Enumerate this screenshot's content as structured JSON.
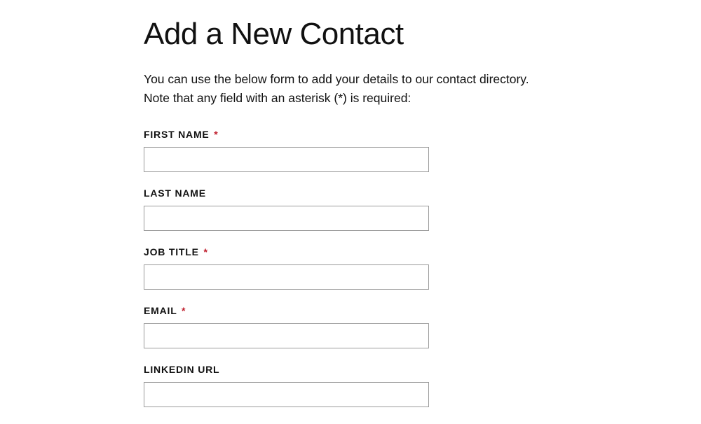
{
  "page": {
    "title": "Add a New Contact",
    "intro": "You can use the below form to add your details to our contact directory. Note that any field with an asterisk (*) is required:"
  },
  "form": {
    "fields": [
      {
        "label": "FIRST NAME",
        "required": true,
        "value": ""
      },
      {
        "label": "LAST NAME",
        "required": false,
        "value": ""
      },
      {
        "label": "JOB TITLE",
        "required": true,
        "value": ""
      },
      {
        "label": "EMAIL",
        "required": true,
        "value": ""
      },
      {
        "label": "LINKEDIN URL",
        "required": false,
        "value": ""
      }
    ],
    "required_marker": "*"
  }
}
